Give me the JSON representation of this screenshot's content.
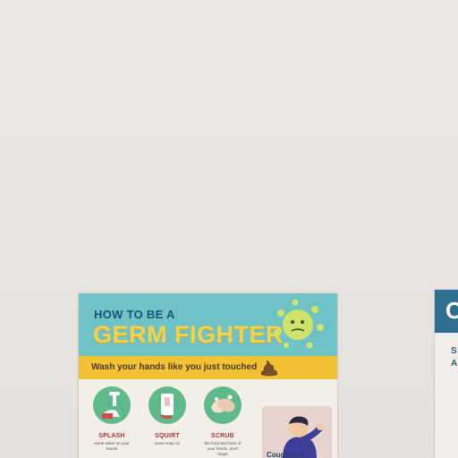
{
  "poster": {
    "title_small": "HOW TO BE A",
    "title_big": "GERM FIGHTER",
    "strip_text": "Wash your hands like you just touched",
    "steps": [
      {
        "label": "SPLASH",
        "desc": "some water on your hands"
      },
      {
        "label": "SQUIRT",
        "desc": "some soap on"
      },
      {
        "label": "SCRUB",
        "desc": "the front and back of your hands, don't forget"
      }
    ],
    "cough_text": "Cough and"
  },
  "poster2": {
    "letter": "C",
    "text_lines": [
      "S",
      "A"
    ]
  },
  "colors": {
    "wall": "#ebe6e2",
    "header_teal": "#6fc3c6",
    "title_yellow": "#f4d24a",
    "strip_yellow": "#f2c234",
    "step_green": "#5fb98a",
    "label_red": "#b2333a"
  }
}
